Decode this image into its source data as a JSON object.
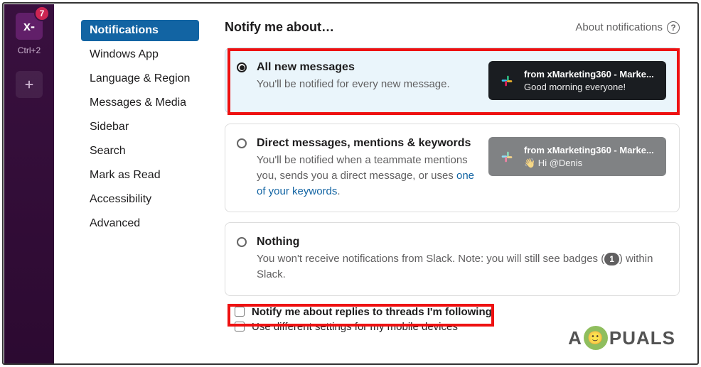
{
  "rail": {
    "ws_label": "x-",
    "badge": "7",
    "shortcut": "Ctrl+2"
  },
  "sidebar": {
    "items": [
      {
        "label": "Notifications",
        "active": true
      },
      {
        "label": "Windows App"
      },
      {
        "label": "Language & Region"
      },
      {
        "label": "Messages & Media"
      },
      {
        "label": "Sidebar"
      },
      {
        "label": "Search"
      },
      {
        "label": "Mark as Read"
      },
      {
        "label": "Accessibility"
      },
      {
        "label": "Advanced"
      }
    ]
  },
  "header": {
    "title": "Notify me about…",
    "about": "About notifications"
  },
  "options": {
    "all": {
      "title": "All new messages",
      "desc": "You'll be notified for every new message."
    },
    "dm": {
      "title": "Direct messages, mentions & keywords",
      "desc_pre": "You'll be notified when a teammate mentions you, sends you a direct message, or uses ",
      "link": "one of your keywords",
      "desc_post": "."
    },
    "nothing": {
      "title": "Nothing",
      "desc_pre": "You won't receive notifications from Slack. Note: you will still see badges (",
      "badge": "1",
      "desc_post": ") within Slack."
    }
  },
  "preview": {
    "from": "from xMarketing360 - Marke...",
    "msg1": "Good morning everyone!",
    "msg2_emoji": "👋",
    "msg2": " Hi @Denis"
  },
  "checks": {
    "threads": "Notify me about replies to threads I'm following",
    "mobile": "Use different settings for my mobile devices"
  },
  "watermark": {
    "pre": "A",
    "post": "PUALS"
  },
  "highlight_color": "#e11"
}
